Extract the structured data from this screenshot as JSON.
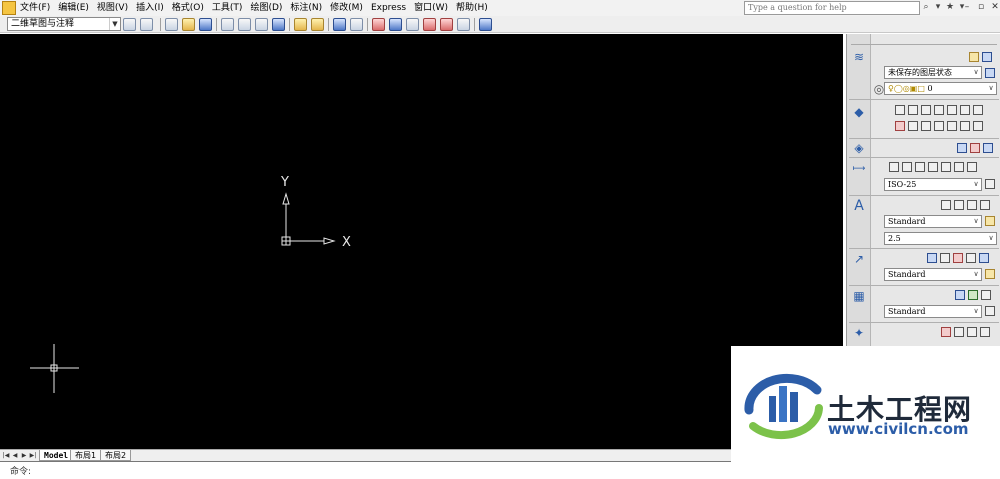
{
  "menu": {
    "items": [
      "文件(F)",
      "编辑(E)",
      "视图(V)",
      "插入(I)",
      "格式(O)",
      "工具(T)",
      "绘图(D)",
      "标注(N)",
      "修改(M)",
      "Express",
      "窗口(W)",
      "帮助(H)"
    ]
  },
  "help": {
    "placeholder": "Type a question for help"
  },
  "toolbar": {
    "workspace": "二维草图与注释"
  },
  "canvas": {
    "ucs_y_label": "Y",
    "ucs_x_label": "X"
  },
  "palette": {
    "layer_state": "未保存的图层状态",
    "layer_current": "0",
    "dim_style": "ISO-25",
    "text_style": "Standard",
    "text_height": "2.5",
    "mleader_style": "Standard",
    "table_style": "Standard"
  },
  "tabs": {
    "items": [
      "Model",
      "布局1",
      "布局2"
    ]
  },
  "command": {
    "prompt": "命令:"
  },
  "watermark": {
    "name": "土木工程网",
    "url": "www.civilcn.com"
  },
  "colors": {
    "canvas_bg": "#000000",
    "ucs_icon": "#e8e8e8",
    "logo_blue": "#2c5da8",
    "logo_green": "#7cc24a"
  }
}
